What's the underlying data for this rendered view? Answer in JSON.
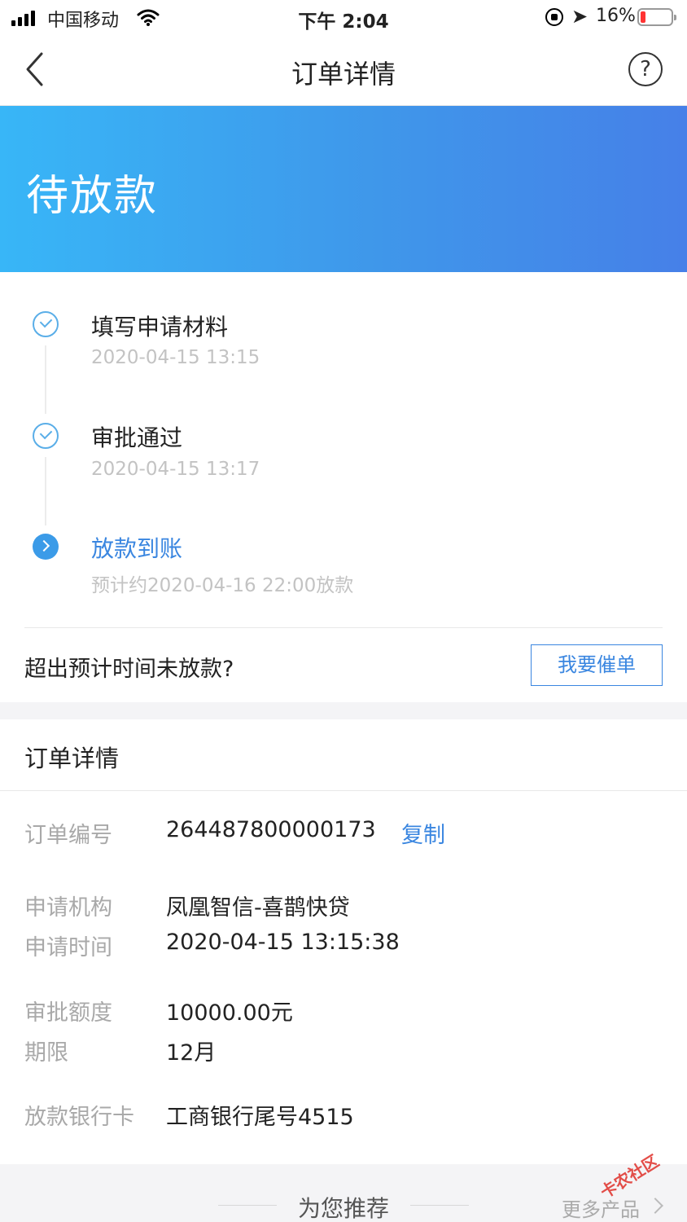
{
  "status_bar": {
    "carrier": "中国移动",
    "time": "下午 2:04",
    "battery_percent": "16%",
    "battery_level": 0.16,
    "icons": [
      "signal-icon",
      "wifi-icon",
      "orientation-lock-icon",
      "location-icon",
      "battery-icon"
    ]
  },
  "nav": {
    "title": "订单详情",
    "back_icon": "chevron-left-icon",
    "help_label": "?"
  },
  "banner": {
    "status": "待放款"
  },
  "progress": {
    "steps": [
      {
        "title": "填写申请材料",
        "time": "2020-04-15 13:15",
        "state": "done",
        "icon": "check-circle-icon"
      },
      {
        "title": "审批通过",
        "time": "2020-04-15 13:17",
        "state": "done",
        "icon": "check-circle-icon"
      },
      {
        "title": "放款到账",
        "time": "预计约2020-04-16 22:00放款",
        "state": "current",
        "icon": "arrow-circle-icon"
      }
    ],
    "overdue_question": "超出预计时间未放款?",
    "urge_button": "我要催单"
  },
  "details": {
    "title": "订单详情",
    "rows": [
      {
        "label": "订单编号",
        "value": "264487800000173"
      },
      {
        "label": "申请机构",
        "value": "凤凰智信-喜鹊快贷"
      },
      {
        "label": "申请时间",
        "value": "2020-04-15 13:15:38"
      },
      {
        "label": "审批额度",
        "value": "10000.00元"
      },
      {
        "label": "期限",
        "value": "12月"
      },
      {
        "label": "放款银行卡",
        "value": "工商银行尾号4515"
      }
    ],
    "copy_label": "复制"
  },
  "recommend": {
    "title": "为您推荐",
    "more": "更多产品"
  },
  "watermark": "卡农社区",
  "colors": {
    "accent": "#3a86e0",
    "banner_start": "#38b6f7",
    "banner_end": "#4680e8",
    "done_icon": "#5aaee8",
    "battery_low": "#ff3333"
  }
}
